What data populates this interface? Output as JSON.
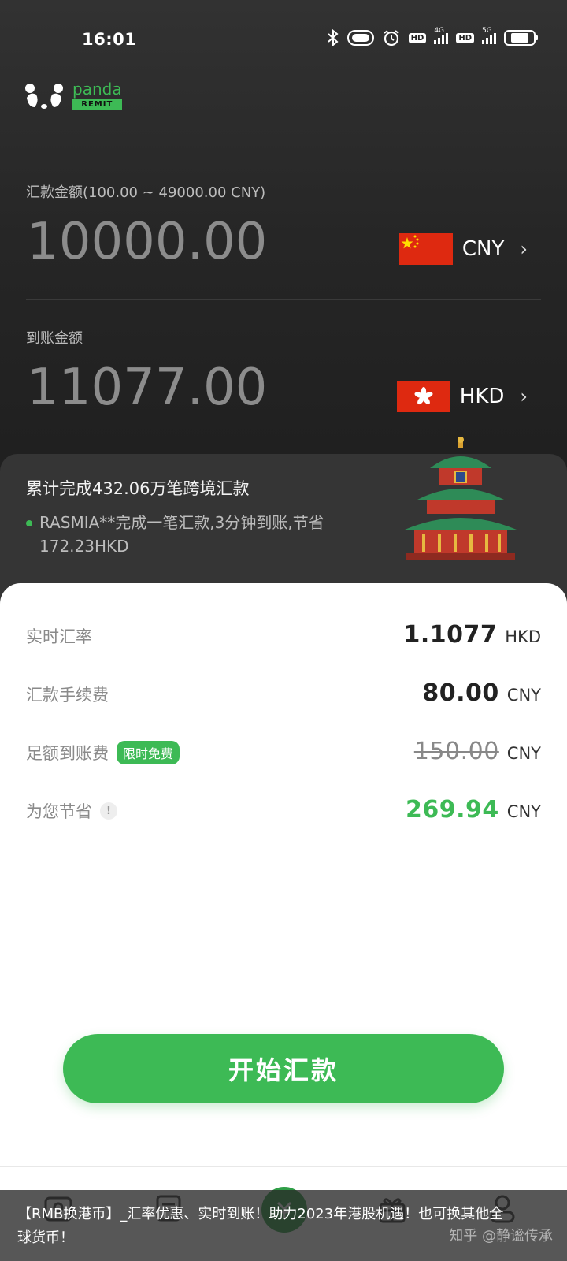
{
  "status_bar": {
    "time": "16:01",
    "icons": [
      "bluetooth-icon",
      "toggle-icon",
      "alarm-icon",
      "hd-icon",
      "signal-4g-icon",
      "hd-icon",
      "signal-5g-icon",
      "battery-icon"
    ],
    "hd_label": "HD",
    "net1": "4G",
    "net2": "5G",
    "battery_level": 0.7
  },
  "brand": {
    "name": "panda",
    "sub": "REMIT",
    "color": "#3dba55"
  },
  "send": {
    "label": "汇款金额(100.00 ~ 49000.00 CNY)",
    "amount": "10000.00",
    "currency": "CNY",
    "flag": "china-flag"
  },
  "receive": {
    "label": "到账金额",
    "amount": "11077.00",
    "currency": "HKD",
    "flag": "hong-kong-flag"
  },
  "promo": {
    "title": "累计完成432.06万笔跨境汇款",
    "news": "RASMIA**完成一笔汇款,3分钟到账,节省172.23HKD",
    "illustration": "temple-of-heaven"
  },
  "details": {
    "rate": {
      "label": "实时汇率",
      "value": "1.1077",
      "unit": "HKD"
    },
    "fee": {
      "label": "汇款手续费",
      "value": "80.00",
      "unit": "CNY"
    },
    "full_fee": {
      "label": "足额到账费",
      "badge": "限时免费",
      "value": "150.00",
      "unit": "CNY"
    },
    "saved": {
      "label": "为您节省",
      "info": "!",
      "value": "269.94",
      "unit": "CNY"
    }
  },
  "cta": {
    "label": "开始汇款"
  },
  "tabbar": {
    "icons": [
      "user-card-icon",
      "orders-icon",
      "exchange-icon",
      "gift-icon",
      "profile-icon"
    ]
  },
  "overlay": {
    "text": "【RMB换港币】_汇率优惠、实时到账！助力2023年港股机遇！也可换其他全球货币！",
    "watermark": "知乎 @静谧传承"
  }
}
